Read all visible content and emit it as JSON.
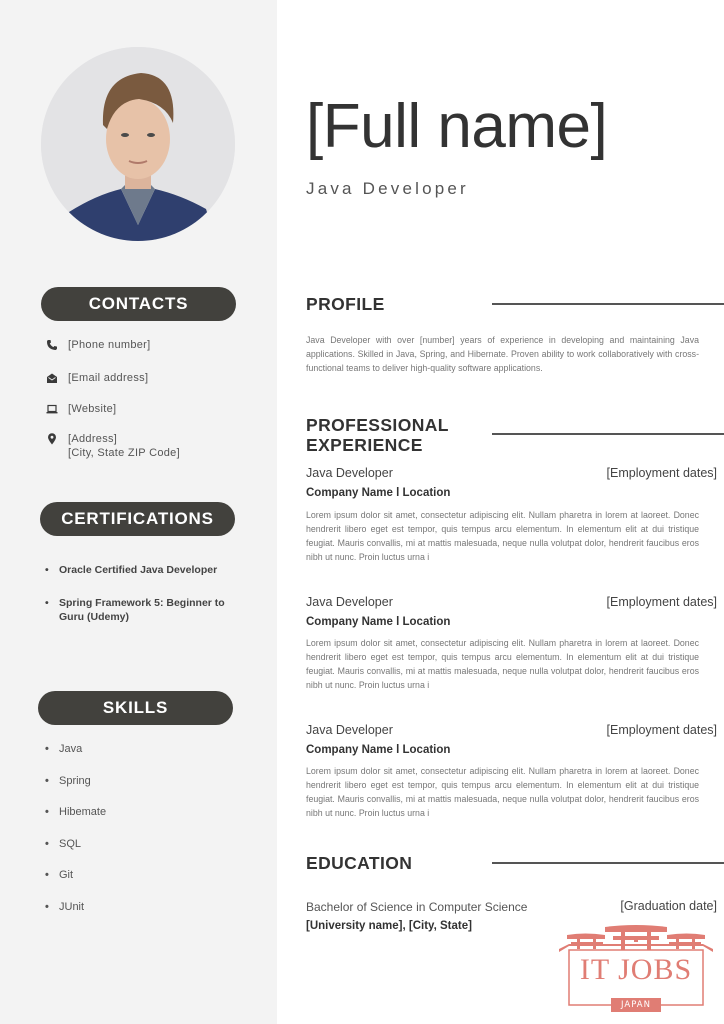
{
  "header": {
    "full_name": "[Full name]",
    "job_title": "Java Developer"
  },
  "sidebar": {
    "photo_alt": "profile-photo",
    "contacts": {
      "heading": "CONTACTS",
      "items": [
        {
          "icon": "phone-icon",
          "lines": [
            "[Phone number]"
          ]
        },
        {
          "icon": "envelope-icon",
          "lines": [
            "[Email address]"
          ]
        },
        {
          "icon": "laptop-icon",
          "lines": [
            "[Website]"
          ]
        },
        {
          "icon": "location-pin-icon",
          "lines": [
            "[Address]",
            "[City, State ZIP Code]"
          ]
        }
      ]
    },
    "certifications": {
      "heading": "CERTIFICATIONS",
      "items": [
        "Oracle Certified Java Developer",
        "Spring Framework 5: Beginner to Guru (Udemy)"
      ]
    },
    "skills": {
      "heading": "SKILLS",
      "items": [
        "Java",
        "Spring",
        "Hibemate",
        "SQL",
        "Git",
        "JUnit"
      ]
    }
  },
  "profile": {
    "heading": "PROFILE",
    "text": "Java Developer with over [number] years of experience in developing and maintaining Java applications. Skilled in Java, Spring, and Hibernate. Proven ability to work collaboratively with cross-functional teams to deliver high-quality software applications."
  },
  "experience": {
    "heading_line1": "PROFESSIONAL",
    "heading_line2": "EXPERIENCE",
    "jobs": [
      {
        "title": "Java Developer",
        "dates": "[Employment dates]",
        "company": "Company Name l Location",
        "description": "Lorem ipsum dolor sit amet, consectetur adipiscing elit. Nullam pharetra in lorem at laoreet. Donec hendrerit libero eget est tempor, quis tempus arcu elementum. In elementum elit at dui tristique feugiat. Mauris convallis, mi at mattis malesuada, neque nulla volutpat dolor, hendrerit faucibus eros nibh ut nunc. Proin luctus urna i"
      },
      {
        "title": "Java Developer",
        "dates": "[Employment dates]",
        "company": "Company Name l Location",
        "description": "Lorem ipsum dolor sit amet, consectetur adipiscing elit. Nullam pharetra in lorem at laoreet. Donec hendrerit libero eget est tempor, quis tempus arcu elementum. In elementum elit at dui tristique feugiat. Mauris convallis, mi at mattis malesuada, neque nulla volutpat dolor, hendrerit faucibus eros nibh ut nunc. Proin luctus urna i"
      },
      {
        "title": "Java Developer",
        "dates": "[Employment dates]",
        "company": "Company Name l Location",
        "description": "Lorem ipsum dolor sit amet, consectetur adipiscing elit. Nullam pharetra in lorem at laoreet. Donec hendrerit libero eget est tempor, quis tempus arcu elementum. In elementum elit at dui tristique feugiat. Mauris convallis, mi at mattis malesuada, neque nulla volutpat dolor, hendrerit faucibus eros nibh ut nunc. Proin luctus urna i"
      }
    ]
  },
  "education": {
    "heading": "EDUCATION",
    "degree": "Bachelor of Science in Computer Science",
    "date": "[Graduation date]",
    "school": "[University name], [City, State]"
  },
  "watermark": {
    "title": "IT JOBS",
    "subtitle": "JAPAN",
    "color": "#e07d74"
  },
  "colors": {
    "sidebar_bg": "#f3f3f3",
    "pill_bg": "#42413d",
    "heading_text": "#333333"
  }
}
